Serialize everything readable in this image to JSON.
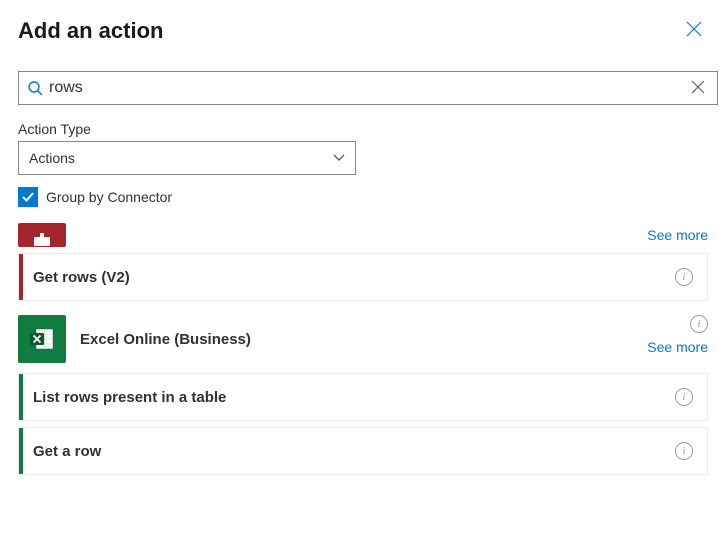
{
  "header": {
    "title": "Add an action"
  },
  "search": {
    "value": "rows"
  },
  "actionType": {
    "label": "Action Type",
    "selected": "Actions"
  },
  "groupBy": {
    "label": "Group by Connector",
    "checked": true
  },
  "connectors": [
    {
      "id": "sql",
      "accent": "#a4262c",
      "seeMore": "See more",
      "actions": [
        {
          "label": "Get rows (V2)"
        }
      ]
    },
    {
      "id": "excel",
      "name": "Excel Online (Business)",
      "accent": "#107c41",
      "seeMore": "See more",
      "actions": [
        {
          "label": "List rows present in a table"
        },
        {
          "label": "Get a row"
        }
      ]
    }
  ]
}
